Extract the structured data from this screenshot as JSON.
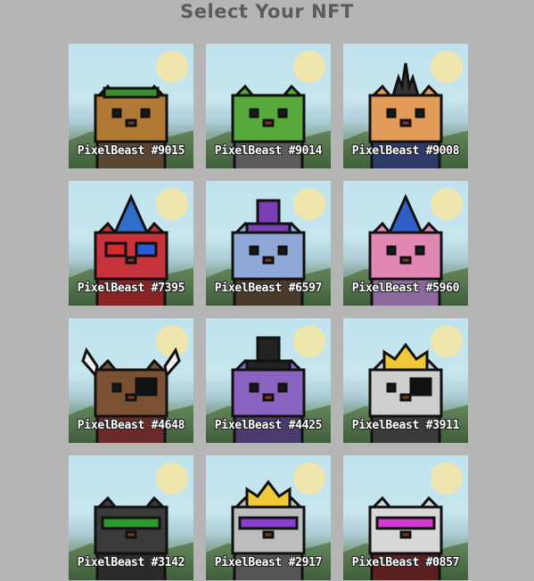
{
  "title": "Select Your NFT",
  "nfts": [
    {
      "name": "PixelBeast #9015",
      "head": "#b07a35",
      "body": "#5a4530",
      "hat": "leaf-wreath",
      "hatColor": "#3f8c2e",
      "eyewear": "none"
    },
    {
      "name": "PixelBeast #9014",
      "head": "#56a93a",
      "body": "#5b5b5b",
      "hat": "none",
      "hatColor": "",
      "eyewear": "none"
    },
    {
      "name": "PixelBeast #9008",
      "head": "#e29b58",
      "body": "#2d3b66",
      "hat": "spike-crown",
      "hatColor": "#333333",
      "eyewear": "none"
    },
    {
      "name": "PixelBeast #7395",
      "head": "#c8323a",
      "body": "#8a2424",
      "hat": "wizard-hat",
      "hatColor": "#2f6fc7",
      "eyewear": "3d-glasses"
    },
    {
      "name": "PixelBeast #6597",
      "head": "#8fa8d8",
      "body": "#4a3a2a",
      "hat": "top-hat",
      "hatColor": "#7b3fb5",
      "eyewear": "none"
    },
    {
      "name": "PixelBeast #5960",
      "head": "#e287b1",
      "body": "#8d6a9e",
      "hat": "wizard-hat",
      "hatColor": "#2f5fc7",
      "eyewear": "none"
    },
    {
      "name": "PixelBeast #4648",
      "head": "#7a5233",
      "body": "#6a2a2a",
      "hat": "horns",
      "hatColor": "#f0f0f0",
      "eyewear": "eye-patch"
    },
    {
      "name": "PixelBeast #4425",
      "head": "#8a63c0",
      "body": "#4b3a6e",
      "hat": "top-hat",
      "hatColor": "#222222",
      "eyewear": "none"
    },
    {
      "name": "PixelBeast #3911",
      "head": "#cfcfcf",
      "body": "#3a3a3a",
      "hat": "crown",
      "hatColor": "#f0c93a",
      "eyewear": "eye-patch"
    },
    {
      "name": "PixelBeast #3142",
      "head": "#3a3a3a",
      "body": "#2a2a2a",
      "hat": "none",
      "hatColor": "",
      "eyewear": "green-shades"
    },
    {
      "name": "PixelBeast #2917",
      "head": "#bdbdbd",
      "body": "#555555",
      "hat": "crown",
      "hatColor": "#f0c93a",
      "eyewear": "purple-shades"
    },
    {
      "name": "PixelBeast #0857",
      "head": "#d8d8d8",
      "body": "#5a2020",
      "hat": "none",
      "hatColor": "",
      "eyewear": "pink-shades"
    }
  ]
}
